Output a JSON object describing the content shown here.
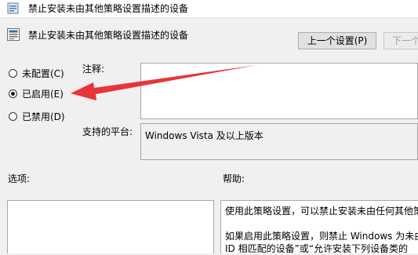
{
  "window": {
    "title": "禁止安装未由其他策略设置描述的设备"
  },
  "header": {
    "title": "禁止安装未由其他策略设置描述的设备"
  },
  "nav": {
    "prev_label": "上一个设置(P)",
    "next_label": "下一个"
  },
  "state": {
    "options": [
      {
        "label": "未配置(C)",
        "checked": false
      },
      {
        "label": "已启用(E)",
        "checked": true
      },
      {
        "label": "已禁用(D)",
        "checked": false
      }
    ]
  },
  "comment": {
    "label": "注释:",
    "value": ""
  },
  "platform": {
    "label": "支持的平台:",
    "value": "Windows Vista 及以上版本"
  },
  "options_section": {
    "label": "选项:"
  },
  "help": {
    "label": "帮助:",
    "line1": "使用此策略设置，可以禁止安装未由任何其他策略",
    "line2": "如果启用此策略设置，则禁止 Windows 为未由",
    "line3": "ID 相匹配的设备”或“允许安装下列设备类的"
  },
  "annotation": {
    "arrow_color": "#e8343a"
  }
}
